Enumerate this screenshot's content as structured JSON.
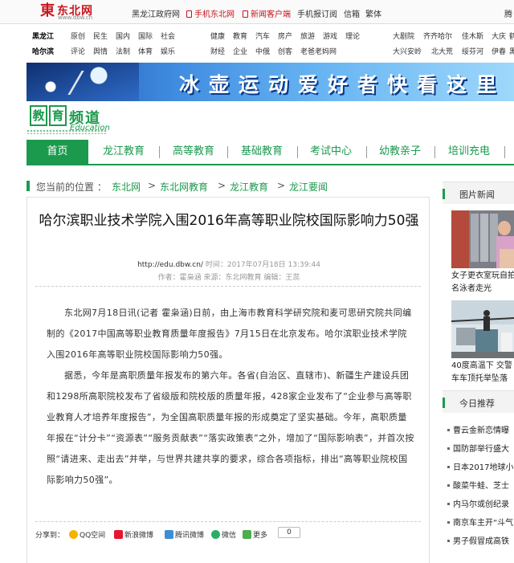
{
  "colors": {
    "brand_red": "#c8151d",
    "channel_green": "#1b9a4d"
  },
  "topbar": {
    "logo_mark": "東",
    "logo_text": "东北网",
    "logo_url": "www.dbw.cn",
    "links": [
      "黑龙江政府网",
      "手机东北网",
      "新闻客户端",
      "手机报订阅",
      "信箱",
      "繁体",
      "腾"
    ]
  },
  "channels": {
    "row1": [
      "黑龙江",
      "原创",
      "民生",
      "国内",
      "国际",
      "社会",
      "健康",
      "教育",
      "汽车",
      "房产",
      "旅游",
      "游戏",
      "理论",
      "大剧院",
      "齐齐哈尔",
      "佳木斯",
      "大庆",
      "鹤"
    ],
    "row2": [
      "哈尔滨",
      "评论",
      "舆情",
      "法制",
      "体育",
      "娱乐",
      "财经",
      "企业",
      "中俄",
      "创客",
      "老爸老妈网",
      "大兴安岭",
      "北大荒",
      "绥芬河",
      "伊春",
      "黑"
    ]
  },
  "banner": {
    "text": "冰壶运动爱好者快看这里"
  },
  "channel_header": {
    "char1": "教",
    "char2": "育",
    "pindao": "频道",
    "en": "Education"
  },
  "nav": {
    "items": [
      "首页",
      "龙江教育",
      "高等教育",
      "基础教育",
      "考试中心",
      "幼教亲子",
      "培训充电"
    ]
  },
  "breadcrumb": {
    "label": "您当前的位置 ：",
    "items": [
      "东北网",
      "东北网教育",
      "龙江教育",
      "龙江要闻"
    ],
    "sep": ">"
  },
  "article": {
    "title": "哈尔滨职业技术学院入围2016年高等职业院校国际影响力50强",
    "url": "http://edu.dbw.cn/",
    "time": "时间：2017年07月18日 13:39:44",
    "byline": "作者：霍枭涵   来源：东北网教育   编辑：王蕊",
    "paragraphs": [
      "东北网7月18日讯(记者 霍枭涵)日前，由上海市教育科学研究院和麦可思研究院共同编制的《2017中国高等职业教育质量年度报告》7月15日在北京发布。哈尔滨职业技术学院入围2016年高等职业院校国际影响力50强。",
      "据悉，今年是高职质量年报发布的第六年。各省(自治区、直辖市)、新疆生产建设兵团和1298所高职院校发布了省级版和院校版的质量年报，428家企业发布了“企业参与高等职业教育人才培养年度报告”，为全国高职质量年报的形成奠定了坚实基础。今年，高职质量年报在“计分卡”“资源表”“服务贡献表”“落实政策表”之外，增加了“国际影响表”，并首次按照“请进来、走出去”并举，与世界共建共享的要求，综合各项指标，排出“高等职业院校国际影响力50强”。"
    ]
  },
  "share": {
    "label": "分享到：",
    "items": [
      "QQ空间",
      "新浪微博",
      "腾讯微博",
      "微信",
      "更多"
    ],
    "count": "0"
  },
  "sidebar": {
    "photo_news_title": "图片新闻",
    "photo_captions": [
      "女子更衣室玩自拍",
      "名泳者走光",
      "40度高温下 交警",
      "车车顶托举坠落"
    ],
    "today_title": "今日推荐",
    "recommend": [
      "曹云金新恋情曝",
      "国防部举行盛大",
      "日本2017地球小",
      "酸菜牛蛙、芝士",
      "内马尔或创纪录",
      "南京车主开“斗气",
      "男子假冒成高铁"
    ]
  }
}
